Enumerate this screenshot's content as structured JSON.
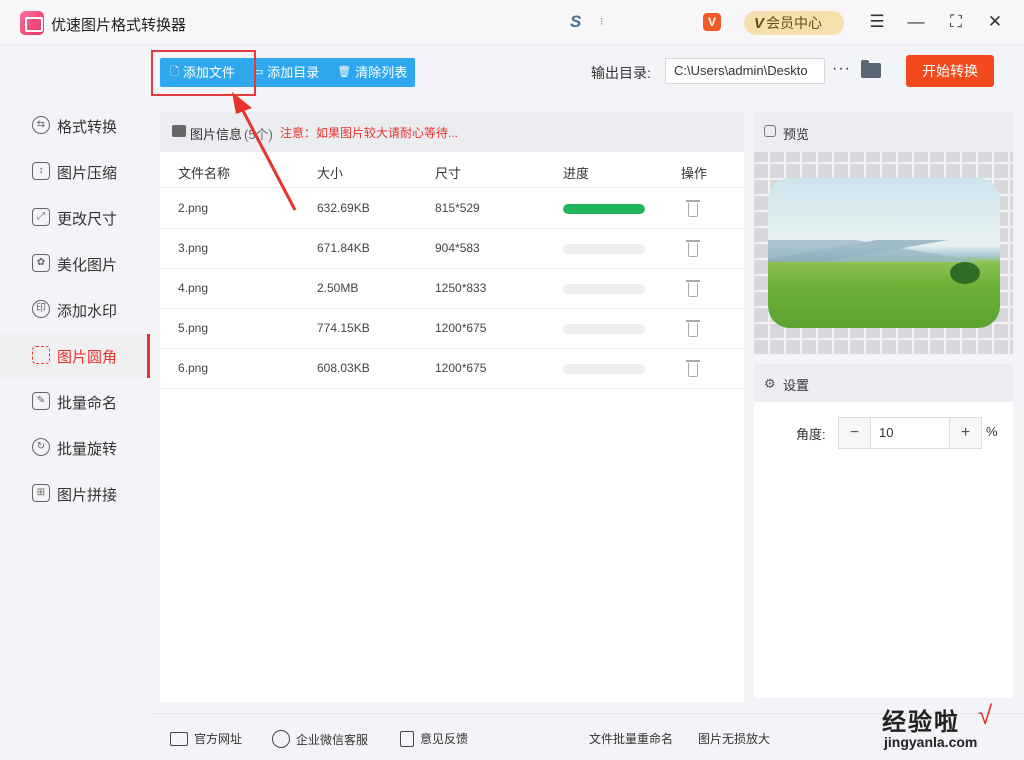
{
  "app": {
    "title": "优速图片格式转换器"
  },
  "titlebar": {
    "vip_mark": "V",
    "vip_label": "会员中心",
    "v_icon": "V"
  },
  "sidebar": {
    "items": [
      {
        "label": "格式转换",
        "icon": "swap-icon"
      },
      {
        "label": "图片压缩",
        "icon": "compress-icon"
      },
      {
        "label": "更改尺寸",
        "icon": "resize-icon"
      },
      {
        "label": "美化图片",
        "icon": "beautify-icon"
      },
      {
        "label": "添加水印",
        "icon": "watermark-icon"
      },
      {
        "label": "图片圆角",
        "icon": "round-corner-icon",
        "active": true
      },
      {
        "label": "批量命名",
        "icon": "rename-icon"
      },
      {
        "label": "批量旋转",
        "icon": "rotate-icon"
      },
      {
        "label": "图片拼接",
        "icon": "stitch-icon"
      }
    ]
  },
  "toolbar": {
    "add_file": "添加文件",
    "add_dir": "添加目录",
    "clear_list": "清除列表",
    "output_label": "输出目录:",
    "output_path": "C:\\Users\\admin\\Deskto",
    "more": "···",
    "start": "开始转换"
  },
  "file_panel": {
    "title": "图片信息",
    "count": "(5个)",
    "note": "注意：如果图片较大请耐心等待...",
    "columns": [
      "文件名称",
      "大小",
      "尺寸",
      "进度",
      "操作"
    ],
    "rows": [
      {
        "name": "2.png",
        "size": "632.69KB",
        "dims": "815*529",
        "progress": 1.0
      },
      {
        "name": "3.png",
        "size": "671.84KB",
        "dims": "904*583",
        "progress": 0
      },
      {
        "name": "4.png",
        "size": "2.50MB",
        "dims": "1250*833",
        "progress": 0
      },
      {
        "name": "5.png",
        "size": "774.15KB",
        "dims": "1200*675",
        "progress": 0
      },
      {
        "name": "6.png",
        "size": "608.03KB",
        "dims": "1200*675",
        "progress": 0
      }
    ]
  },
  "preview": {
    "title": "预览"
  },
  "settings": {
    "title": "设置",
    "angle_label": "角度:",
    "angle_value": "10",
    "unit": "%",
    "minus": "−",
    "plus": "+"
  },
  "footer": {
    "website": "官方网址",
    "wechat": "企业微信客服",
    "feedback": "意见反馈",
    "batch_rename": "文件批量重命名",
    "lossless": "图片无损放大"
  },
  "watermark": {
    "main": "经验啦",
    "check": "√",
    "sub": "jingyanla.com"
  },
  "colors": {
    "accent_blue": "#2fa7ee",
    "accent_red": "#e8332a",
    "start_orange": "#f2491d",
    "progress_green": "#22b45a"
  }
}
